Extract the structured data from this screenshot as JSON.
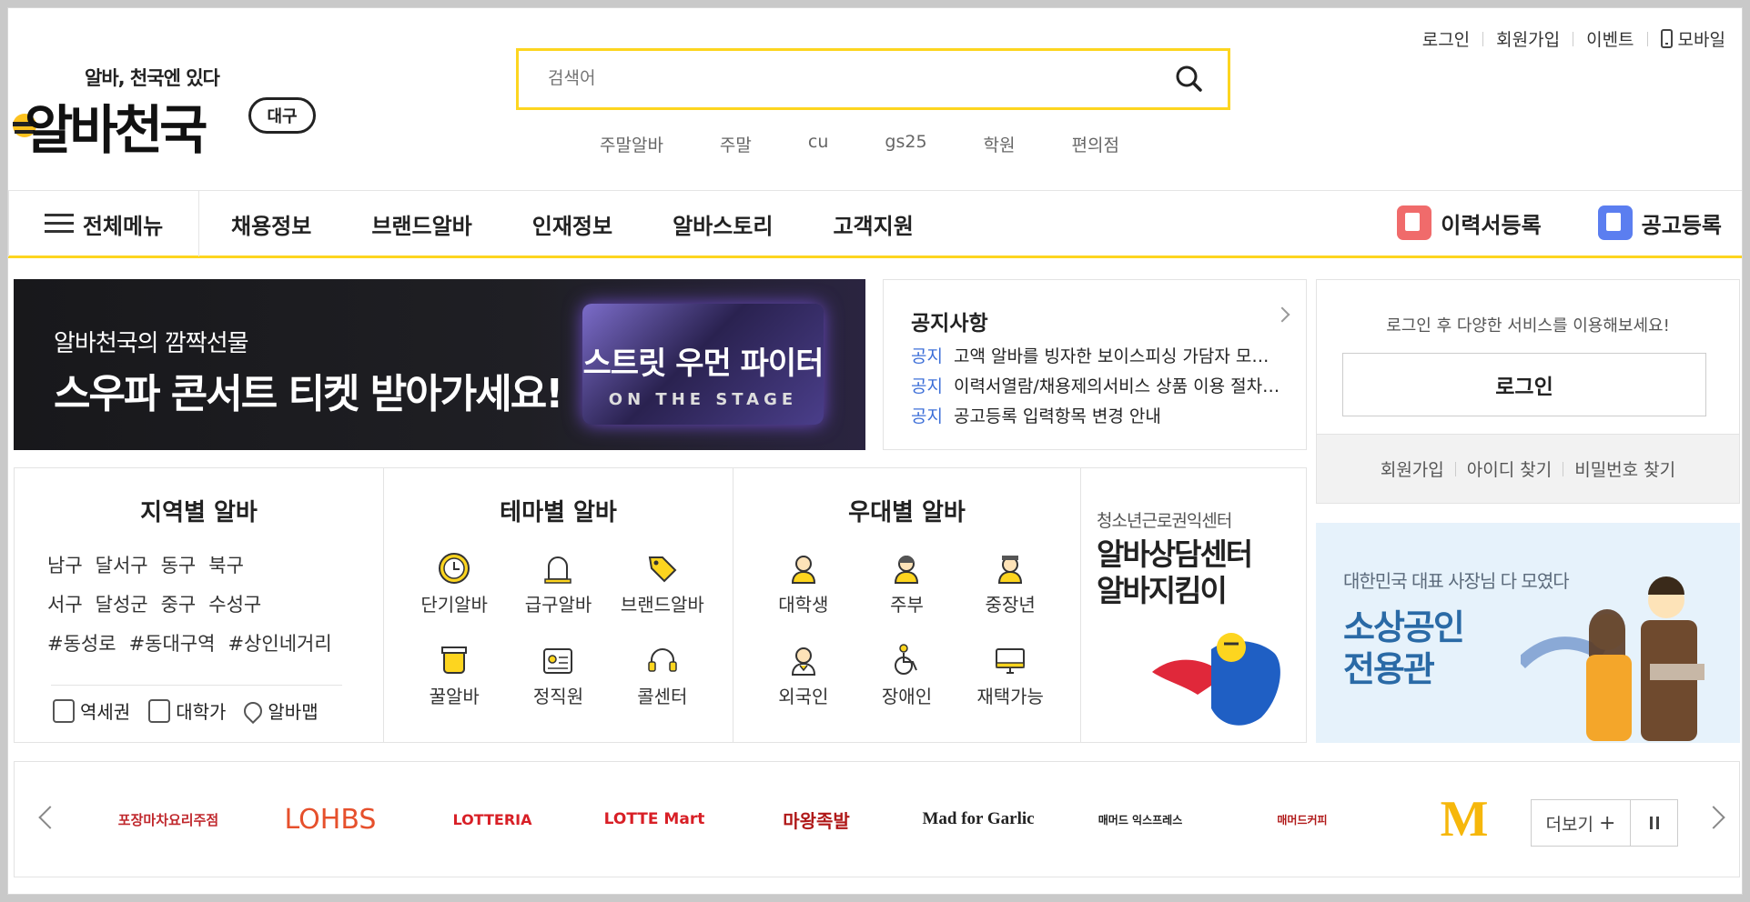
{
  "util": {
    "login": "로그인",
    "signup": "회원가입",
    "event": "이벤트",
    "mobile": "모바일"
  },
  "logo": {
    "slogan": "알바, 천국엔 있다",
    "name": "알바천국",
    "region": "대구"
  },
  "search": {
    "placeholder": "검색어",
    "keywords": [
      "주말알바",
      "주말",
      "cu",
      "gs25",
      "학원",
      "편의점"
    ]
  },
  "gnb": {
    "all": "전체메뉴",
    "menu": [
      "채용정보",
      "브랜드알바",
      "인재정보",
      "알바스토리",
      "고객지원"
    ],
    "resume": "이력서등록",
    "post": "공고등록"
  },
  "banner": {
    "line1": "알바천국의 깜짝선물",
    "line2": "스우파 콘서트 티켓 받아가세요!",
    "poster_title": "스트릿 우먼 파이터",
    "poster_sub": "ON THE STAGE"
  },
  "notice": {
    "title": "공지사항",
    "tag": "공지",
    "items": [
      "고액 알바를 빙자한 보이스피싱 가담자 모집 주의",
      "이력서열람/채용제의서비스 상품 이용 절차 변경",
      "공고등록 입력항목 변경 안내"
    ]
  },
  "login": {
    "message": "로그인 후 다양한 서비스를 이용해보세요!",
    "button": "로그인",
    "links": [
      "회원가입",
      "아이디 찾기",
      "비밀번호 찾기"
    ]
  },
  "region_col": {
    "title": "지역별 알바",
    "rows": [
      [
        "남구",
        "달서구",
        "동구",
        "북구"
      ],
      [
        "서구",
        "달성군",
        "중구",
        "수성구"
      ],
      [
        "#동성로",
        "#동대구역",
        "#상인네거리"
      ]
    ],
    "quick": [
      "역세권",
      "대학가",
      "알바맵"
    ]
  },
  "theme_col": {
    "title": "테마별 알바",
    "items": [
      "단기알바",
      "급구알바",
      "브랜드알바",
      "꿀알바",
      "정직원",
      "콜센터"
    ]
  },
  "benefit_col": {
    "title": "우대별 알바",
    "items": [
      "대학생",
      "주부",
      "중장년",
      "외국인",
      "장애인",
      "재택가능"
    ]
  },
  "promo1": {
    "small": "청소년근로권익센터",
    "big": [
      "알바상담센터",
      "알바지킴이"
    ]
  },
  "promo2": {
    "small": "대한민국 대표 사장님 다 모였다",
    "big": [
      "소상공인",
      "전용관"
    ]
  },
  "brands": {
    "logos": [
      "포장마차요리주점",
      "LOHBS",
      "LOTTERIA",
      "LOTTE Mart",
      "마왕족발",
      "Mad for Garlic",
      "매머드 익스프레스",
      "매머드커피",
      "M"
    ],
    "more": "더보기"
  },
  "colors": {
    "accent": "#fdd51f",
    "notice_tag": "#3d6fd8",
    "promo2_text": "#2a6aa6"
  }
}
